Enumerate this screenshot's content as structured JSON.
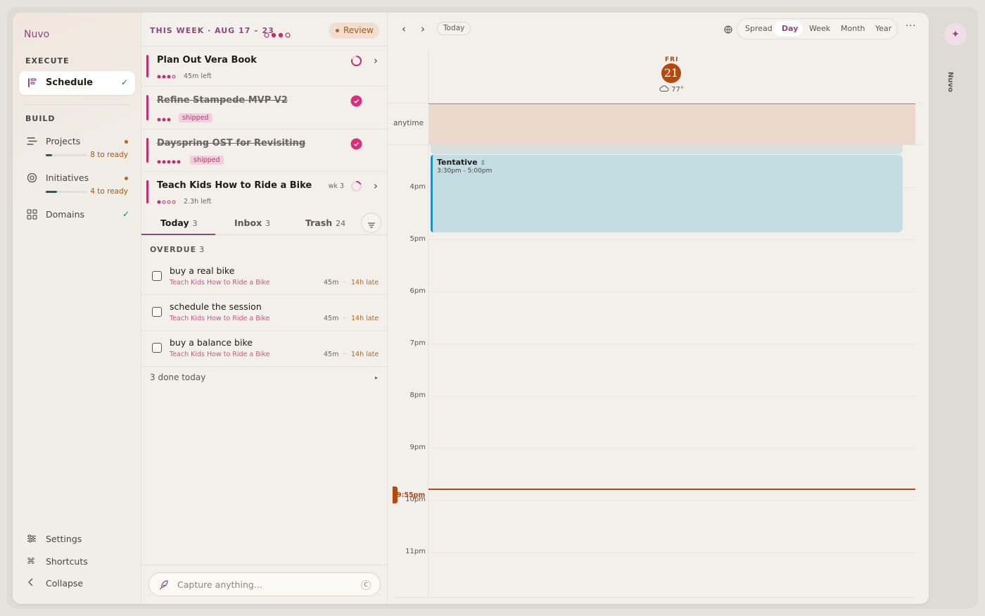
{
  "app": {
    "name": "Nuvo"
  },
  "sidebar": {
    "execute_label": "EXECUTE",
    "schedule_label": "Schedule",
    "build_label": "BUILD",
    "projects": {
      "label": "Projects",
      "ready": "8 to ready",
      "progress": 0.15
    },
    "initiatives": {
      "label": "Initiatives",
      "ready": "4 to ready",
      "progress": 0.28
    },
    "domains": {
      "label": "Domains"
    },
    "settings": "Settings",
    "shortcuts": "Shortcuts",
    "collapse": "Collapse"
  },
  "week": {
    "label": "THIS WEEK · AUG 17 – 23",
    "review": "Review",
    "projects": [
      {
        "title": "Plan Out Vera Book",
        "meta": "45m left",
        "done": false,
        "dots_filled": 3,
        "dots_total": 4
      },
      {
        "title": "Refine Stampede MVP V2",
        "tag": "shipped",
        "done": true,
        "dots_filled": 3,
        "dots_total": 3
      },
      {
        "title": "Dayspring OST for Revisiting",
        "tag": "shipped",
        "done": true,
        "dots_filled": 5,
        "dots_total": 5
      },
      {
        "title": "Teach Kids How to Ride a Bike",
        "meta": "2.3h left",
        "wk": "wk 3",
        "done": false,
        "dots_filled": 1,
        "dots_total": 4
      }
    ]
  },
  "tabs": [
    {
      "label": "Today",
      "count": "3"
    },
    {
      "label": "Inbox",
      "count": "3"
    },
    {
      "label": "Trash",
      "count": "24"
    }
  ],
  "overdue": {
    "label": "OVERDUE",
    "count": "3"
  },
  "tasks": [
    {
      "title": "buy a real bike",
      "project": "Teach Kids How to Ride a Bike",
      "duration": "45m",
      "late": "14h late"
    },
    {
      "title": "schedule the session",
      "project": "Teach Kids How to Ride a Bike",
      "duration": "45m",
      "late": "14h late"
    },
    {
      "title": "buy a balance bike",
      "project": "Teach Kids How to Ride a Bike",
      "duration": "45m",
      "late": "14h late"
    }
  ],
  "done_today": "3 done today",
  "capture": {
    "placeholder": "Capture anything...",
    "shortcut": "C"
  },
  "calendar": {
    "today_label": "Today",
    "views": [
      "Spread",
      "Day",
      "Week",
      "Month",
      "Year"
    ],
    "active_view": "Day",
    "day_name": "FRI",
    "day_number": "21",
    "weather": "77°",
    "anytime_label": "anytime",
    "hours": [
      "4pm",
      "5pm",
      "6pm",
      "7pm",
      "8pm",
      "9pm",
      "10pm",
      "11pm"
    ],
    "event": {
      "title": "Tentative",
      "time": "3:30pm - 5:00pm"
    },
    "now_label": "9:55pm"
  },
  "rail": {
    "label": "Nuvo"
  },
  "colors": {
    "accent": "#8b4a7a",
    "project_bar": "#c22f6e",
    "now": "#b24a10",
    "event": "#c3dde2"
  }
}
